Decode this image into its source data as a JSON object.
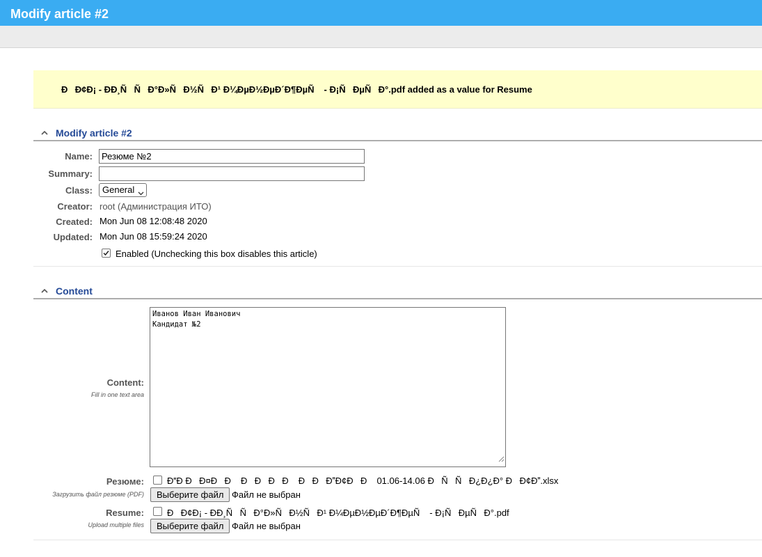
{
  "header": {
    "title": "Modify article #2"
  },
  "notice": {
    "message": "ÐÐ¢Ð¡ - ÐÐ¸ÑÑÐ°Ð»ÑÐ½ÑÐ¹ Ð¼ÐµÐ½ÐµÐ´Ð¶ÐµÑ - Ð¡ÑÐµÑÐ°.pdf added as a value for Resume"
  },
  "section_article": {
    "title": "Modify article #2",
    "fields": {
      "name_label": "Name:",
      "name_value": "Резюме №2",
      "summary_label": "Summary:",
      "summary_value": "",
      "class_label": "Class:",
      "class_value": "General",
      "creator_label": "Creator:",
      "creator_value": "root (Администрация ИТО)",
      "created_label": "Created:",
      "created_value": "Mon Jun 08 12:08:48 2020",
      "updated_label": "Updated:",
      "updated_value": "Mon Jun 08 15:59:24 2020",
      "enabled_label": "Enabled (Unchecking this box disables this article)",
      "enabled_checked": true
    }
  },
  "section_content": {
    "title": "Content",
    "content_label": "Content:",
    "content_help": "Fill in one text area",
    "content_lines": [
      "Иванов Иван Иванович",
      "Кандидат №2"
    ],
    "resume_ru_label": "Резюме:",
    "resume_ru_help": "Загрузить файл резюме (PDF)",
    "resume_ru_file": "ÐÐ ÐÐ¤ÐÐ ÐÐÐÐ ÐÐÐÐ¢ÐÐ 01.06-14.06 ÐÑÑÐ¿Ð¿Ð° ÐÐ¢Ð.xlsx",
    "resume_label": "Resume:",
    "resume_help": "Upload multiple files",
    "resume_file": "ÐÐ¢Ð¡ - ÐÐ¸ÑÑÐ°Ð»ÑÐ½ÑÐ¹ Ð¼ÐµÐ½ÐµÐ´Ð¶ÐµÑ - Ð¡ÑÐµÑÐ°.pdf",
    "choose_file_button": "Выберите файл",
    "no_file_text": "Файл не выбран"
  }
}
